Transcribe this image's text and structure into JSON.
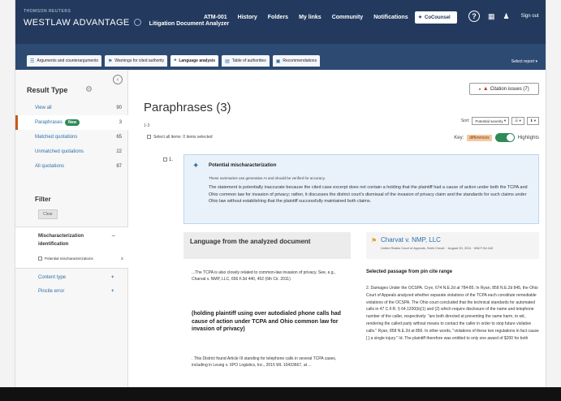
{
  "topbar": {
    "brand_small": "THOMSON REUTERS",
    "brand_name": "WESTLAW ADVANTAGE",
    "brand_sub": "Litigation Document Analyzer",
    "nav": [
      "ATM-001",
      "History",
      "Folders",
      "My links",
      "Community",
      "Notifications"
    ],
    "connect_label": "CoCounsel",
    "help_icon": "?",
    "signout_label": "Sign out"
  },
  "tabs": [
    {
      "label": "Arguments and counterarguments",
      "icon": "list-icon"
    },
    {
      "label": "Warnings for cited authority",
      "icon": "flag-icon"
    },
    {
      "label": "Language analysis",
      "icon": "quote-icon"
    },
    {
      "label": "Table of authorities",
      "icon": "table-icon"
    },
    {
      "label": "Recommendations",
      "icon": "doc-icon"
    }
  ],
  "select_report": "Select report",
  "sidebar": {
    "result_type_label": "Result Type",
    "items": [
      {
        "label": "View all",
        "count": "90"
      },
      {
        "label": "Paraphrases",
        "badge": "New",
        "count": "3"
      },
      {
        "label": "Matched quotations",
        "count": "65"
      },
      {
        "label": "Unmatched quotations",
        "count": "22"
      },
      {
        "label": "All quotations",
        "count": "87"
      }
    ],
    "filter_label": "Filter",
    "clear_label": "Clear",
    "filter_section_title": "Mischaracterization identification",
    "filter_option": "Potential mischaracterizations",
    "filter_option_count": "3",
    "content_type_label": "Content type",
    "pincite_error_label": "Pincite error"
  },
  "main": {
    "citation_issues": "Citation issues (7)",
    "title": "Paraphrases (3)",
    "range": "1-3",
    "select_all": "Select all items",
    "items_selected": "0 items selected",
    "sort_label": "Sort:",
    "sort_value": "Potential severity",
    "key_label": "Key:",
    "differences_tag": "differences",
    "highlights_label": "Highlights",
    "row_number": "1.",
    "alert_title": "Potential mischaracterization",
    "alert_sub": "These summaries use generative AI and should be verified for accuracy.",
    "alert_body": "The statement is potentially inaccurate because the cited case excerpt does not contain a holding that the plaintiff had a cause of action under both the TCPA and Ohio common law for invasion of privacy; rather, it discusses the district court's dismissal of the invasion of privacy claim and the standards for such claims under Ohio law without establishing that the plaintiff successfully maintained both claims.",
    "left_heading": "Language from the analyzed document",
    "left_para1": "...The TCPA is also closely related to common-law invasion of privacy. See, e.g., Charvat v. NMP, LLC, 656 F.3d 440, 452 (6th Cir. 2011)",
    "left_holding": "(holding plaintiff using over autodialed phone calls had cause of action under TCPA and Ohio common law for invasion of privacy)",
    "left_para2": ". This District found Article III standing for telephone calls in several TCPA cases, including in Leung v. XPO Logistics, Inc., 2015 WL 10433667, at ...",
    "case_name": "Charvat v. NMP, LLC",
    "case_meta": "United States Court of Appeals, Sixth Circuit. · August 30, 2011 · 656 F.3d 440",
    "right_heading": "Selected passage from pin cite range",
    "right_body": "2. Damages Under the OCSPA. Crye, 674 N.E.2d at 784-85. In Ryan, 858 N.E.2d 845, the Ohio Court of Appeals analyzed whether separate violations of the TCPA each constitute remediable violations of the OCSPA. The Ohio court concluded that the technical standards for automated calls in 47 C.F.R. § 64.1200(b)(1) and (2) which require disclosure of the name and telephone number of the caller, respectively: \"are both directed at preventing the same harm, to wit, rendering the called party without means to contact the caller in order to stop future violative calls.\" Ryan, 858 N.E.2d at 856. In other words, \"violations of these two regulations in fact cause [ ] a single injury.\" Id. The plaintiff therefore was entitled to only one award of $200 for both"
  },
  "colors": {
    "header": "#233a5e",
    "tabbar": "#2d4a73",
    "accent": "#2e8b57",
    "link": "#2d6ea8",
    "active_border": "#c35c1a"
  }
}
